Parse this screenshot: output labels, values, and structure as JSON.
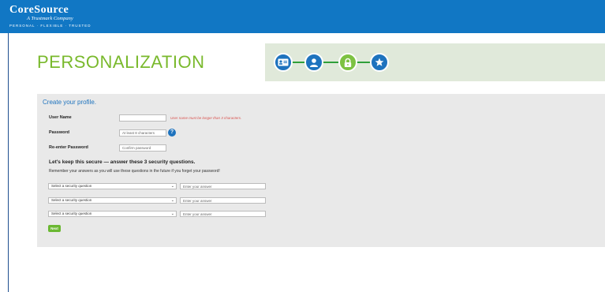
{
  "header": {
    "logo_name": "CoreSource",
    "logo_subtitle": "A Trustmark Company",
    "logo_tagline": "PERSONAL · FLEXIBLE · TRUSTED"
  },
  "page": {
    "title": "PERSONALIZATION"
  },
  "steps": [
    {
      "icon": "id-card-icon",
      "color": "#1e73be"
    },
    {
      "icon": "user-icon",
      "color": "#1e73be"
    },
    {
      "icon": "lock-icon",
      "color": "#7dc242",
      "active": true
    },
    {
      "icon": "star-icon",
      "color": "#1e73be"
    }
  ],
  "form": {
    "title": "Create your profile.",
    "username_label": "User Name",
    "username_value": "",
    "username_error": "User name must be longer than 3 characters.",
    "password_label": "Password",
    "password_placeholder": "At least 8 characters",
    "password_help": "?",
    "reenter_label": "Re-enter Password",
    "reenter_placeholder": "Confirm password"
  },
  "security": {
    "heading": "Let's keep this secure — answer these 3 security questions.",
    "note": "Remember your answers as you will use these questions in the future if you forget your password!",
    "questions": [
      {
        "select": "Select a security question",
        "answer_placeholder": "Enter your answer"
      },
      {
        "select": "Select a security question",
        "answer_placeholder": "Enter your answer"
      },
      {
        "select": "Select a security question",
        "answer_placeholder": "Enter your answer"
      }
    ]
  },
  "actions": {
    "next_label": "Next"
  },
  "colors": {
    "header_blue": "#1177c4",
    "title_green": "#79b92c",
    "accent_blue": "#1e73be",
    "error_red": "#d9534f",
    "button_green": "#6bb832"
  }
}
